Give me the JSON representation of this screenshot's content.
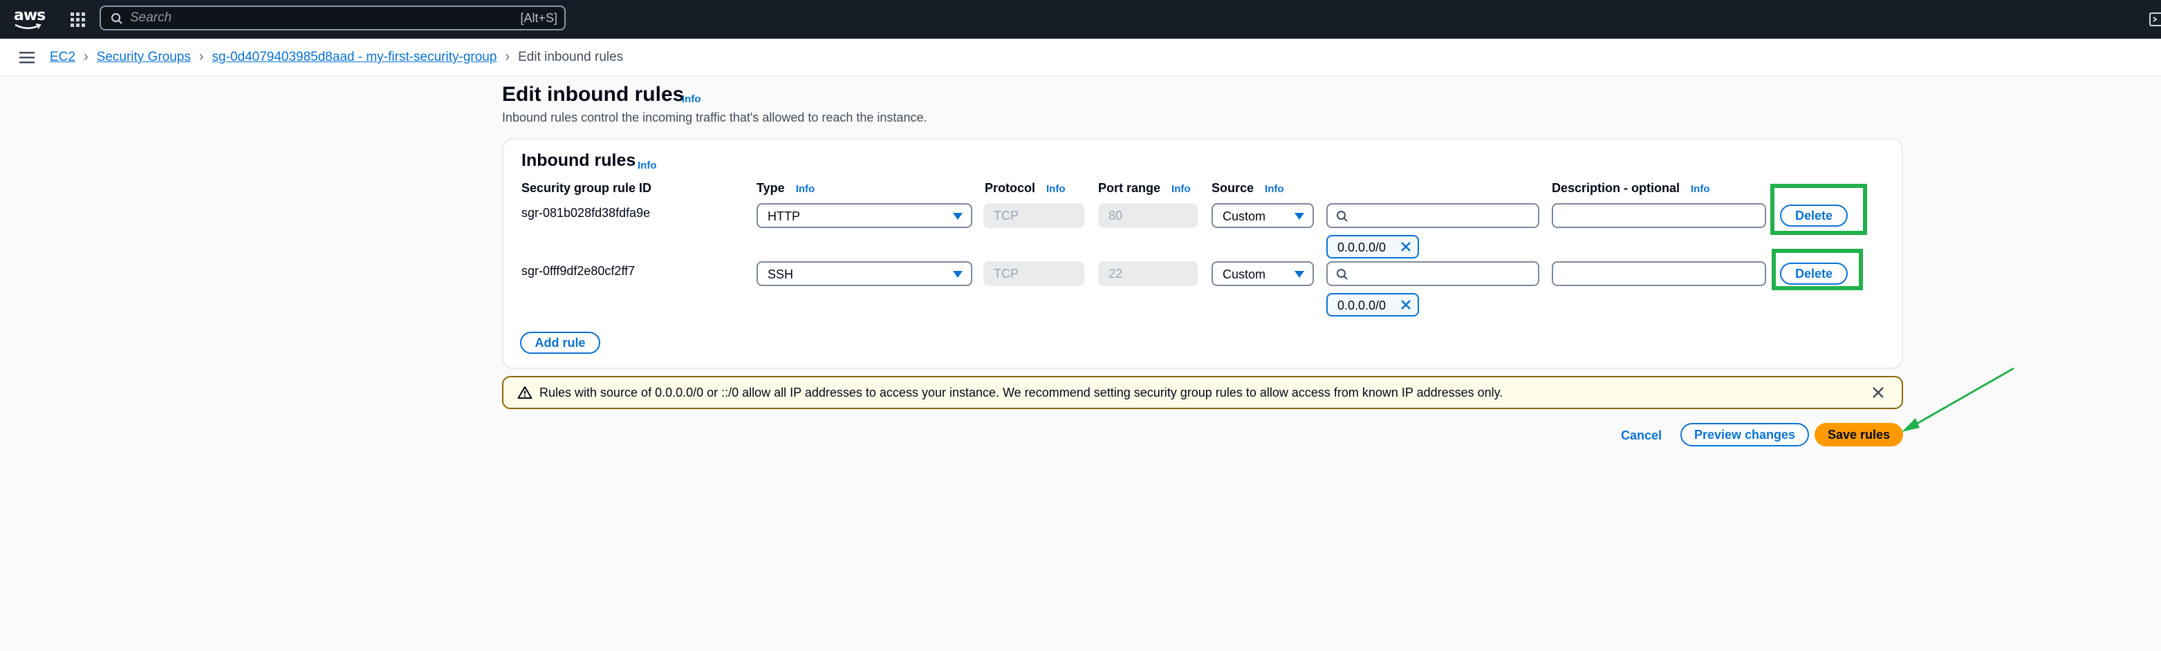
{
  "nav": {
    "logo_text": "aws",
    "search_placeholder": "Search",
    "search_shortcut": "[Alt+S]"
  },
  "breadcrumb": {
    "items": [
      "EC2",
      "Security Groups",
      "sg-0d4079403985d8aad - my-first-security-group"
    ],
    "current": "Edit inbound rules"
  },
  "header": {
    "title": "Edit inbound rules",
    "info": "Info",
    "description": "Inbound rules control the incoming traffic that's allowed to reach the instance."
  },
  "container": {
    "title": "Inbound rules",
    "info": "Info",
    "columns": {
      "rule_id": "Security group rule ID",
      "type": "Type",
      "protocol": "Protocol",
      "port_range": "Port range",
      "source": "Source",
      "description": "Description - optional",
      "info": "Info"
    },
    "rules": [
      {
        "id": "sgr-081b028fd38fdfa9e",
        "type": "HTTP",
        "protocol": "TCP",
        "port": "80",
        "source": "Custom",
        "cidr": "0.0.0.0/0",
        "description": "",
        "delete_label": "Delete"
      },
      {
        "id": "sgr-0fff9df2e80cf2ff7",
        "type": "SSH",
        "protocol": "TCP",
        "port": "22",
        "source": "Custom",
        "cidr": "0.0.0.0/0",
        "description": "",
        "delete_label": "Delete"
      }
    ],
    "add_rule_label": "Add rule"
  },
  "alert": {
    "text": "Rules with source of 0.0.0.0/0 or ::/0 allow all IP addresses to access your instance. We recommend setting security group rules to allow access from known IP addresses only."
  },
  "actions": {
    "cancel": "Cancel",
    "preview": "Preview changes",
    "save": "Save rules"
  },
  "colors": {
    "nav_bg": "#161d26",
    "link": "#0972d3",
    "primary_button": "#ff9900",
    "annotation": "#22b14c",
    "warning_border": "#8d6605"
  }
}
